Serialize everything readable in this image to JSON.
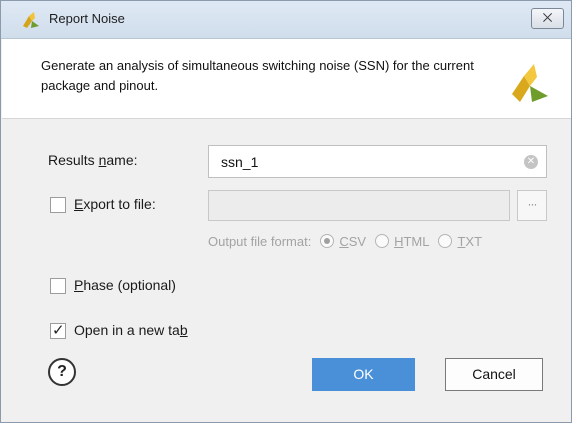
{
  "window": {
    "title": "Report Noise",
    "close_label": "⨉"
  },
  "header": {
    "description": "Generate an analysis of simultaneous switching noise (SSN) for the current package and pinout."
  },
  "form": {
    "results_name_label_pre": "Results ",
    "results_name_label_u": "n",
    "results_name_label_post": "ame:",
    "results_name_value": "ssn_1",
    "export_label_pre": "",
    "export_label_u": "E",
    "export_label_post": "xport to file:",
    "export_checked": false,
    "export_path_value": "",
    "browse_label": "···",
    "output_format_label": "Output file format:",
    "formats": [
      {
        "u": "C",
        "rest": "SV",
        "selected": true
      },
      {
        "u": "H",
        "rest": "TML",
        "selected": false
      },
      {
        "u": "T",
        "rest": "XT",
        "selected": false
      }
    ],
    "phase_label_u": "P",
    "phase_label_rest": "hase (optional)",
    "phase_checked": false,
    "open_tab_label_pre": "Open in a new ta",
    "open_tab_label_u": "b",
    "open_tab_checked": true
  },
  "buttons": {
    "help": "?",
    "ok": "OK",
    "cancel": "Cancel"
  },
  "colors": {
    "accent": "#4a90d9",
    "logo_yellow": "#f5c518",
    "logo_green": "#7aa82e"
  }
}
